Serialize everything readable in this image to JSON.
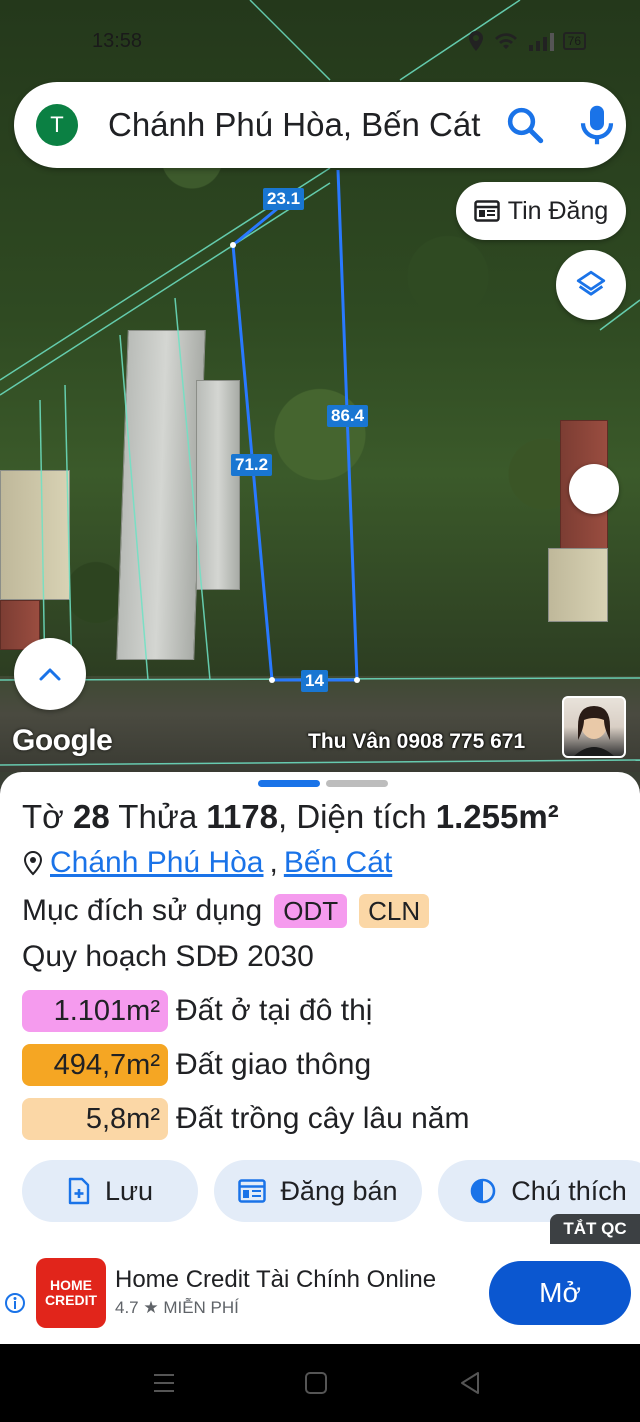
{
  "status": {
    "time": "13:58",
    "battery": "76"
  },
  "search": {
    "avatar_letter": "T",
    "text": "Chánh Phú Hòa, Bến Cát"
  },
  "map": {
    "chip_label": "Tin Đăng",
    "dimensions": {
      "top": "23.1",
      "right": "86.4",
      "left": "71.2",
      "bottom": "14"
    },
    "logo_text": "Google",
    "watermark": "Thu Vân 0908 775 671"
  },
  "parcel": {
    "to_label": "Tờ",
    "to_number": "28",
    "thua_label": "Thửa",
    "thua_number": "1178",
    "area_label": ", Diện tích",
    "area_value": "1.255m²",
    "commune": "Chánh Phú Hòa",
    "separator": ",",
    "district": "Bến Cát",
    "purpose_label": "Mục đích sử dụng",
    "purpose_tags": [
      "ODT",
      "CLN"
    ],
    "plan_label": "Quy hoạch SDĐ 2030",
    "planning": [
      {
        "area": "1.101m²",
        "label": "Đất ở tại đô thị",
        "color": "#f59bee"
      },
      {
        "area": "494,7m²",
        "label": "Đất giao thông",
        "color": "#f5a623"
      },
      {
        "area": "5,8m²",
        "label": "Đất trồng cây lâu năm",
        "color": "#fbd7a6"
      }
    ]
  },
  "actions": {
    "save": "Lưu",
    "sell": "Đăng bán",
    "legend": "Chú thích"
  },
  "ad": {
    "badge": "TẮT QC",
    "logo_text": "HOME CREDIT",
    "title": "Home Credit Tài Chính Online",
    "rating": "4.7 ★ MIỄN PHÍ",
    "open": "Mở"
  },
  "colors": {
    "accent": "#1a73e8",
    "parcel_line": "#2979ff",
    "odt_tag": "#f59bee",
    "cln_tag": "#fbd7a6"
  }
}
